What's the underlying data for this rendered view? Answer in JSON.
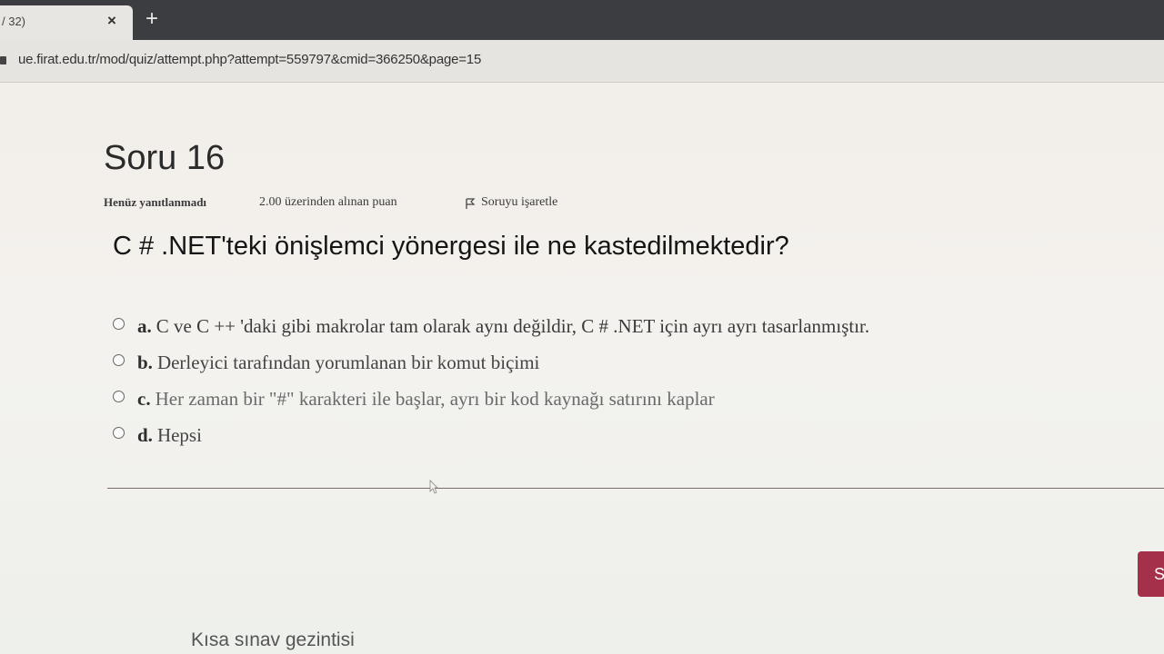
{
  "browser": {
    "tab_title": "/ 32)",
    "tab_close": "×",
    "new_tab": "+",
    "url": "ue.firat.edu.tr/mod/quiz/attempt.php?attempt=559797&cmid=366250&page=15"
  },
  "question": {
    "title": "Soru 16",
    "status": "Henüz yanıtlanmadı",
    "grade": "2.00 üzerinden alınan puan",
    "flag_label": "Soruyu işaretle",
    "text": "C # .NET'teki önişlemci yönergesi ile ne kastedilmektedir?",
    "answers": [
      {
        "letter": "a.",
        "text": "C ve C ++ 'daki gibi makrolar tam olarak aynı değildir, C # .NET için ayrı ayrı tasarlanmıştır."
      },
      {
        "letter": "b.",
        "text": "Derleyici tarafından yorumlanan bir komut biçimi"
      },
      {
        "letter": "c.",
        "text": "Her zaman bir \"#\" karakteri ile başlar, ayrı bir kod kaynağı satırını kaplar"
      },
      {
        "letter": "d.",
        "text": "Hepsi"
      }
    ]
  },
  "side_button_label": "S",
  "quiz_nav": {
    "title": "Kısa sınav gezintisi"
  },
  "colors": {
    "accent": "#a5304a",
    "divider": "#7b6a66"
  }
}
